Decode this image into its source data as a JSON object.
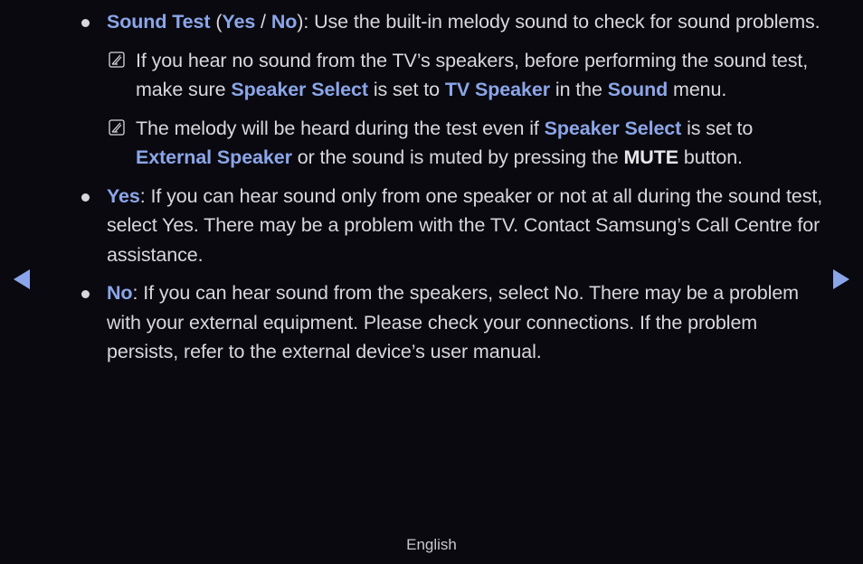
{
  "items": [
    {
      "term": "Sound Test",
      "paren_open": " (",
      "opt1": "Yes",
      "slash": " / ",
      "opt2": "No",
      "desc": "): Use the built-in melody sound to check for sound problems.",
      "notes": [
        {
          "t1": "If you hear no sound from the TV’s speakers, before performing the sound test, make sure ",
          "h1": "Speaker Select",
          "t2": " is set to ",
          "h2": "TV Speaker",
          "t3": " in the ",
          "h3": "Sound",
          "t4": " menu."
        },
        {
          "t1": "The melody will be heard during the test even if ",
          "h1": "Speaker Select",
          "t2": " is set to ",
          "h2": "External Speaker",
          "t3": " or the sound is muted by pressing the ",
          "b1": "MUTE",
          "t4": " button."
        }
      ]
    },
    {
      "term": "Yes",
      "desc": ": If you can hear sound only from one speaker or not at all during the sound test, select Yes. There may be a problem with the TV. Contact Samsung’s Call Centre for assistance."
    },
    {
      "term": "No",
      "desc": ": If you can hear sound from the speakers, select No. There may be a problem with your external equipment. Please check your connections. If the problem persists, refer to the external device’s user manual."
    }
  ],
  "nav": {
    "prev_icon": "triangle-left-icon",
    "next_icon": "triangle-right-icon"
  },
  "footer": {
    "language": "English"
  },
  "colors": {
    "background": "#0a0910",
    "highlight": "#8ba6e8",
    "text": "#d8d8dc"
  }
}
